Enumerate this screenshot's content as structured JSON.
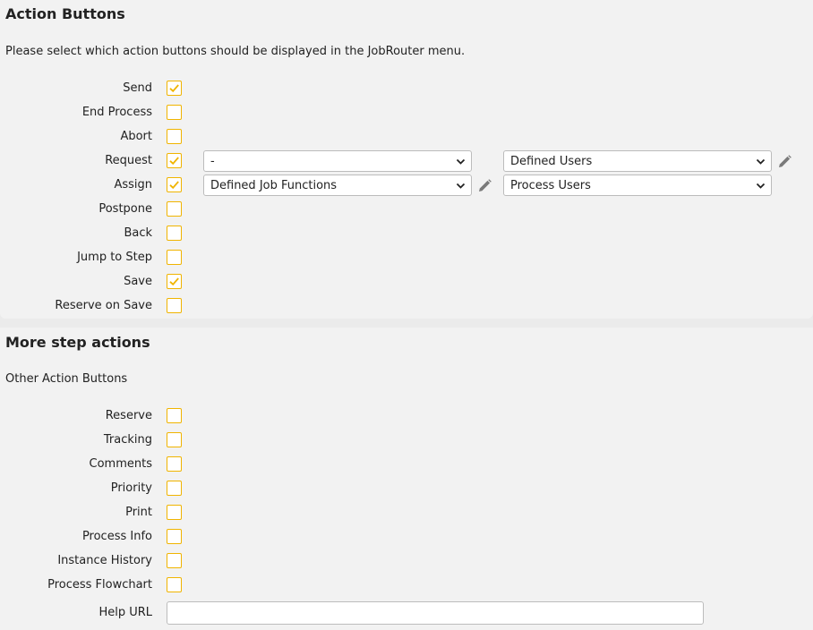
{
  "section1": {
    "title": "Action Buttons",
    "description": "Please select which action buttons should be displayed in the JobRouter menu.",
    "items": [
      {
        "label": "Send",
        "checked": true
      },
      {
        "label": "End Process",
        "checked": false
      },
      {
        "label": "Abort",
        "checked": false
      },
      {
        "label": "Request",
        "checked": true
      },
      {
        "label": "Assign",
        "checked": true
      },
      {
        "label": "Postpone",
        "checked": false
      },
      {
        "label": "Back",
        "checked": false
      },
      {
        "label": "Jump to Step",
        "checked": false
      },
      {
        "label": "Save",
        "checked": true
      },
      {
        "label": "Reserve on Save",
        "checked": false
      }
    ],
    "request_select_1": "-",
    "request_select_2": "Defined Users",
    "assign_select_1": "Defined Job Functions",
    "assign_select_2": "Process Users"
  },
  "section2": {
    "title": "More step actions",
    "description": "Other Action Buttons",
    "items": [
      {
        "label": "Reserve",
        "checked": false
      },
      {
        "label": "Tracking",
        "checked": false
      },
      {
        "label": "Comments",
        "checked": false
      },
      {
        "label": "Priority",
        "checked": false
      },
      {
        "label": "Print",
        "checked": false
      },
      {
        "label": "Process Info",
        "checked": false
      },
      {
        "label": "Instance History",
        "checked": false
      },
      {
        "label": "Process Flowchart",
        "checked": false
      }
    ],
    "help_url_label": "Help URL",
    "help_url_value": ""
  },
  "colors": {
    "checkbox_border": "#f0b400",
    "background": "#ebebeb",
    "panel": "#f2f2f2"
  },
  "icons": {
    "checkmark": "checkmark-icon",
    "dropdown": "chevron-down-icon",
    "edit": "pencil-icon"
  }
}
